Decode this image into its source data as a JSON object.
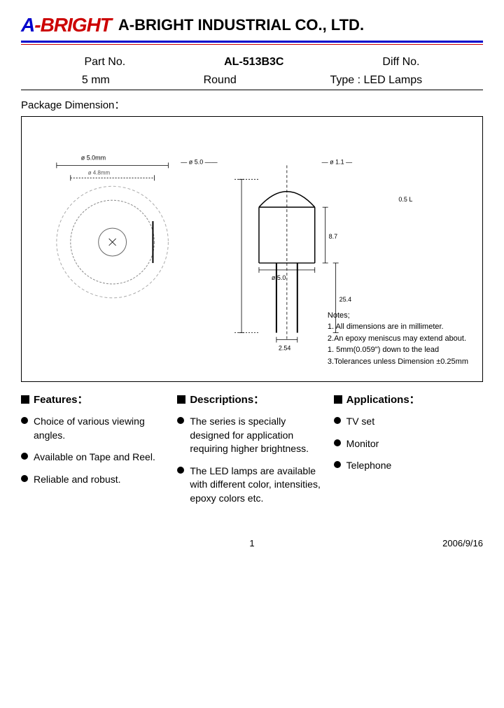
{
  "header": {
    "logo_a": "A",
    "logo_hyphen": "-",
    "logo_bright": "BRIGHT",
    "company_name": "A-BRIGHT INDUSTRIAL CO., LTD."
  },
  "part_info": {
    "part_no_label": "Part No.",
    "part_no_value": "AL-513B3C",
    "diff_no_label": "Diff No.",
    "size_label": "5 mm",
    "shape_label": "Round",
    "type_label": "Type : LED Lamps"
  },
  "package_title": "Package Dimension：",
  "diagram_notes": {
    "title": "Notes;",
    "note1": "1. All dimensions are in millimeter.",
    "note2": "2.An epoxy meniscus may extend about.",
    "note3": "  1. 5mm(0.059\") down to the lead",
    "note4": "3.Tolerances unless Dimension ±0.25mm"
  },
  "columns": {
    "features": {
      "header": "Features：",
      "items": [
        "Choice of various viewing angles.",
        "Available on Tape and Reel.",
        "Reliable and robust."
      ]
    },
    "descriptions": {
      "header": "Descriptions：",
      "items": [
        "The series is specially designed for application requiring higher brightness.",
        "The LED lamps are available with different color, intensities, epoxy colors etc."
      ]
    },
    "applications": {
      "header": "Applications：",
      "items": [
        "TV set",
        "Monitor",
        "Telephone"
      ]
    }
  },
  "footer": {
    "page": "1",
    "date": "2006/9/16"
  }
}
